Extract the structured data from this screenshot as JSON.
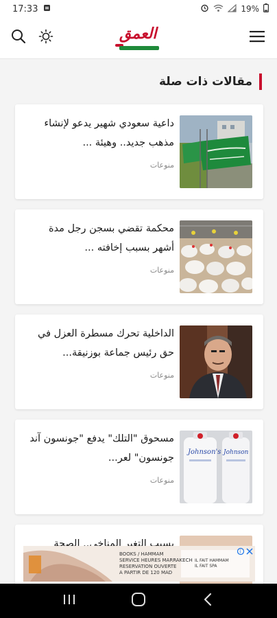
{
  "status_bar": {
    "time": "17:33",
    "battery": "19%"
  },
  "header": {
    "logo_text": "العمق",
    "icons": {
      "search": "search-icon",
      "theme": "sun-icon",
      "menu": "hamburger-menu-icon"
    }
  },
  "section": {
    "title": "مقالات ذات صلة"
  },
  "articles": [
    {
      "title": "داعية سعودي شهير يدعو لإنشاء مذهب جديد.. وهيئة ...",
      "category": "منوعات",
      "image": "saudi-flags-image"
    },
    {
      "title": "محكمة تقضي بسجن رجل مدة أشهر بسبب إخافته ...",
      "category": "منوعات",
      "image": "chickens-image"
    },
    {
      "title": "الداخلية تحرك مسطرة العزل في حق رئيس جماعة بوزنيقة...",
      "category": "منوعات",
      "image": "man-portrait-image"
    },
    {
      "title": "مسحوق \"التلك\" يدفع \"جونسون آند جونسون\" لعر...",
      "category": "منوعات",
      "image": "talc-bottles-image"
    },
    {
      "title": "بسبب التغير المناخي.. الصحة",
      "category": "",
      "image": "partial-image"
    }
  ],
  "ad": {
    "line1": "BOOKS / HAMMAM",
    "line2": "SERVICE HEURES MARRAKECH",
    "line3": "RESERVATION OUVERTE",
    "line4": "A PARTIR DE 120 MAD",
    "side1": "IL FAIT HAMMAM",
    "side2": "IL FAIT SPA",
    "close_icon": "ad-close-icon"
  },
  "nav": {
    "recents": "recents-icon",
    "home": "home-icon",
    "back": "back-icon"
  }
}
